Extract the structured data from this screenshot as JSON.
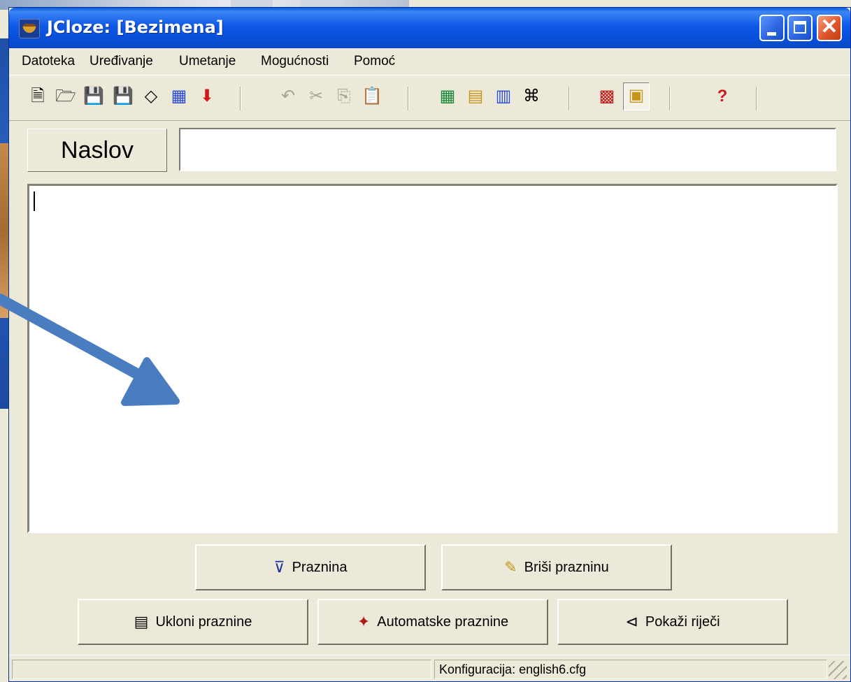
{
  "window": {
    "title": "JCloze: [Bezimena]"
  },
  "menu": {
    "items": [
      {
        "label": "Datoteka"
      },
      {
        "label": "Uređivanje"
      },
      {
        "label": "Umetanje"
      },
      {
        "label": "Mogućnosti"
      },
      {
        "label": "Pomoć"
      }
    ]
  },
  "toolbar": {
    "icons": [
      "new-file-icon",
      "open-folder-icon",
      "save-icon",
      "save-as-icon",
      "eraser-icon",
      "web-export-icon",
      "arrow-down-icon",
      "undo-icon",
      "cut-icon",
      "copy-icon",
      "paste-icon",
      "insert-picture-icon",
      "insert-link-icon",
      "web-page-icon",
      "html-icon",
      "config-icon",
      "layout-icon",
      "help-icon"
    ]
  },
  "form": {
    "title_button": "Naslov",
    "title_value": "",
    "text_value": ""
  },
  "actions": {
    "praznina": "Praznina",
    "brisi": "Briši prazninu",
    "ukloni": "Ukloni praznine",
    "auto": "Automatske praznine",
    "pokazi": "Pokaži riječi"
  },
  "status": {
    "config": "Konfiguracija: english6.cfg"
  },
  "colors": {
    "titlebar": "#0751dc",
    "window_bg": "#ece9d8",
    "annotation_arrow": "#4a7dbf"
  }
}
